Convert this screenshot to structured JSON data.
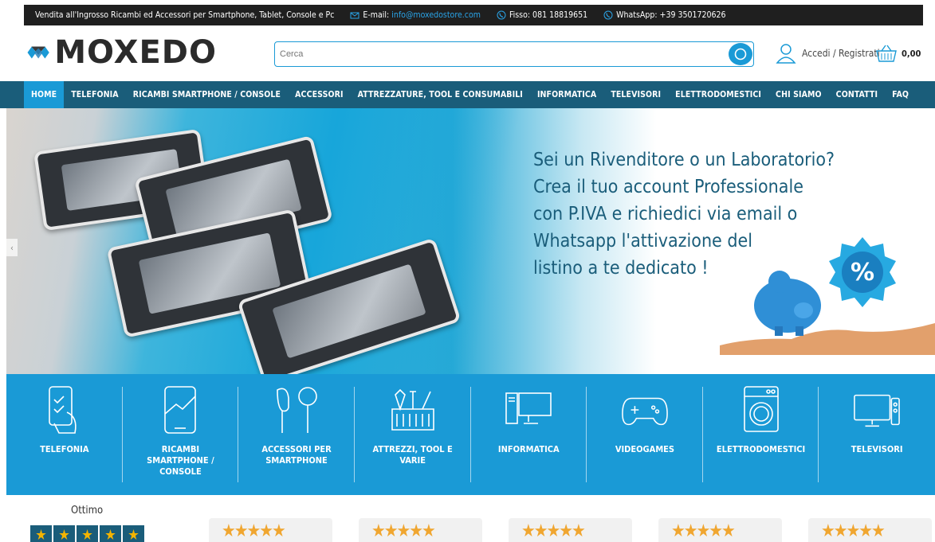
{
  "topbar": {
    "tagline": "Vendita all'Ingrosso Ricambi ed Accessori per Smartphone, Tablet, Console e Pc",
    "email_label": "E-mail:",
    "email_value": "info@moxedostore.com",
    "phone_label": "Fisso: 081 18819651",
    "whatsapp_label": "WhatsApp: +39 3501720626"
  },
  "header": {
    "logo_text": "MOXEDO",
    "search_placeholder": "Cerca",
    "account_label": "Accedi / Registrati",
    "cart_total": "0,00"
  },
  "nav": {
    "items": [
      {
        "label": "HOME",
        "active": true
      },
      {
        "label": "TELEFONIA"
      },
      {
        "label": "RICAMBI SMARTPHONE / CONSOLE"
      },
      {
        "label": "ACCESSORI"
      },
      {
        "label": "ATTREZZATURE, TOOL E CONSUMABILI"
      },
      {
        "label": "INFORMATICA"
      },
      {
        "label": "TELEVISORI"
      },
      {
        "label": "ELETTRODOMESTICI"
      },
      {
        "label": "CHI SIAMO"
      },
      {
        "label": "CONTATTI"
      },
      {
        "label": "FAQ"
      }
    ]
  },
  "hero": {
    "lines": [
      "Sei un Rivenditore o un Laboratorio?",
      "Crea il tuo account Professionale",
      "con P.IVA e richiedici via email o",
      "Whatsapp l'attivazione del",
      "listino a te dedicato !"
    ],
    "prev_arrow": "‹",
    "badge_text": "%"
  },
  "categories": [
    {
      "label": "TELEFONIA",
      "icon": "phone-hand-icon"
    },
    {
      "label": "RICAMBI SMARTPHONE / CONSOLE",
      "icon": "broken-phone-icon"
    },
    {
      "label": "ACCESSORI PER SMARTPHONE",
      "icon": "earphones-icon"
    },
    {
      "label": "ATTREZZI, TOOL E VARIE",
      "icon": "toolbox-icon"
    },
    {
      "label": "INFORMATICA",
      "icon": "desktop-computer-icon"
    },
    {
      "label": "VIDEOGAMES",
      "icon": "gamepad-icon"
    },
    {
      "label": "ELETTRODOMESTICI",
      "icon": "washing-machine-icon"
    },
    {
      "label": "TELEVISORI",
      "icon": "television-icon"
    }
  ],
  "reviews": {
    "rating_title": "Ottimo",
    "star_glyph": "★",
    "card_stars": "★★★★★"
  },
  "colors": {
    "brand_blue": "#1a9ad6",
    "nav_dark": "#1a5d7a",
    "topbar_bg": "#1f1f1f",
    "star_gold": "#f0a630"
  }
}
